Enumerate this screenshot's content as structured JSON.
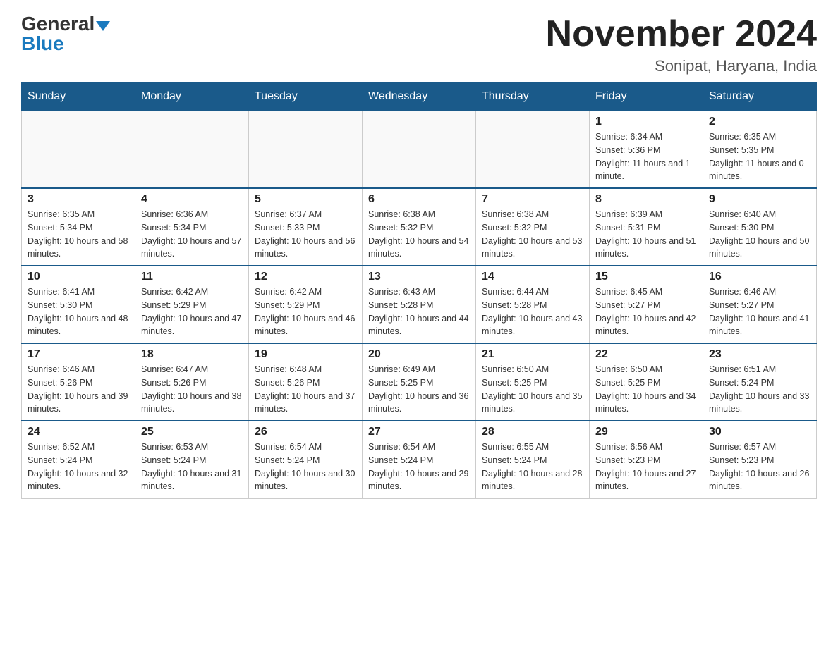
{
  "logo": {
    "general": "General",
    "blue": "Blue"
  },
  "title": "November 2024",
  "location": "Sonipat, Haryana, India",
  "days_of_week": [
    "Sunday",
    "Monday",
    "Tuesday",
    "Wednesday",
    "Thursday",
    "Friday",
    "Saturday"
  ],
  "weeks": [
    [
      {
        "day": "",
        "info": ""
      },
      {
        "day": "",
        "info": ""
      },
      {
        "day": "",
        "info": ""
      },
      {
        "day": "",
        "info": ""
      },
      {
        "day": "",
        "info": ""
      },
      {
        "day": "1",
        "info": "Sunrise: 6:34 AM\nSunset: 5:36 PM\nDaylight: 11 hours and 1 minute."
      },
      {
        "day": "2",
        "info": "Sunrise: 6:35 AM\nSunset: 5:35 PM\nDaylight: 11 hours and 0 minutes."
      }
    ],
    [
      {
        "day": "3",
        "info": "Sunrise: 6:35 AM\nSunset: 5:34 PM\nDaylight: 10 hours and 58 minutes."
      },
      {
        "day": "4",
        "info": "Sunrise: 6:36 AM\nSunset: 5:34 PM\nDaylight: 10 hours and 57 minutes."
      },
      {
        "day": "5",
        "info": "Sunrise: 6:37 AM\nSunset: 5:33 PM\nDaylight: 10 hours and 56 minutes."
      },
      {
        "day": "6",
        "info": "Sunrise: 6:38 AM\nSunset: 5:32 PM\nDaylight: 10 hours and 54 minutes."
      },
      {
        "day": "7",
        "info": "Sunrise: 6:38 AM\nSunset: 5:32 PM\nDaylight: 10 hours and 53 minutes."
      },
      {
        "day": "8",
        "info": "Sunrise: 6:39 AM\nSunset: 5:31 PM\nDaylight: 10 hours and 51 minutes."
      },
      {
        "day": "9",
        "info": "Sunrise: 6:40 AM\nSunset: 5:30 PM\nDaylight: 10 hours and 50 minutes."
      }
    ],
    [
      {
        "day": "10",
        "info": "Sunrise: 6:41 AM\nSunset: 5:30 PM\nDaylight: 10 hours and 48 minutes."
      },
      {
        "day": "11",
        "info": "Sunrise: 6:42 AM\nSunset: 5:29 PM\nDaylight: 10 hours and 47 minutes."
      },
      {
        "day": "12",
        "info": "Sunrise: 6:42 AM\nSunset: 5:29 PM\nDaylight: 10 hours and 46 minutes."
      },
      {
        "day": "13",
        "info": "Sunrise: 6:43 AM\nSunset: 5:28 PM\nDaylight: 10 hours and 44 minutes."
      },
      {
        "day": "14",
        "info": "Sunrise: 6:44 AM\nSunset: 5:28 PM\nDaylight: 10 hours and 43 minutes."
      },
      {
        "day": "15",
        "info": "Sunrise: 6:45 AM\nSunset: 5:27 PM\nDaylight: 10 hours and 42 minutes."
      },
      {
        "day": "16",
        "info": "Sunrise: 6:46 AM\nSunset: 5:27 PM\nDaylight: 10 hours and 41 minutes."
      }
    ],
    [
      {
        "day": "17",
        "info": "Sunrise: 6:46 AM\nSunset: 5:26 PM\nDaylight: 10 hours and 39 minutes."
      },
      {
        "day": "18",
        "info": "Sunrise: 6:47 AM\nSunset: 5:26 PM\nDaylight: 10 hours and 38 minutes."
      },
      {
        "day": "19",
        "info": "Sunrise: 6:48 AM\nSunset: 5:26 PM\nDaylight: 10 hours and 37 minutes."
      },
      {
        "day": "20",
        "info": "Sunrise: 6:49 AM\nSunset: 5:25 PM\nDaylight: 10 hours and 36 minutes."
      },
      {
        "day": "21",
        "info": "Sunrise: 6:50 AM\nSunset: 5:25 PM\nDaylight: 10 hours and 35 minutes."
      },
      {
        "day": "22",
        "info": "Sunrise: 6:50 AM\nSunset: 5:25 PM\nDaylight: 10 hours and 34 minutes."
      },
      {
        "day": "23",
        "info": "Sunrise: 6:51 AM\nSunset: 5:24 PM\nDaylight: 10 hours and 33 minutes."
      }
    ],
    [
      {
        "day": "24",
        "info": "Sunrise: 6:52 AM\nSunset: 5:24 PM\nDaylight: 10 hours and 32 minutes."
      },
      {
        "day": "25",
        "info": "Sunrise: 6:53 AM\nSunset: 5:24 PM\nDaylight: 10 hours and 31 minutes."
      },
      {
        "day": "26",
        "info": "Sunrise: 6:54 AM\nSunset: 5:24 PM\nDaylight: 10 hours and 30 minutes."
      },
      {
        "day": "27",
        "info": "Sunrise: 6:54 AM\nSunset: 5:24 PM\nDaylight: 10 hours and 29 minutes."
      },
      {
        "day": "28",
        "info": "Sunrise: 6:55 AM\nSunset: 5:24 PM\nDaylight: 10 hours and 28 minutes."
      },
      {
        "day": "29",
        "info": "Sunrise: 6:56 AM\nSunset: 5:23 PM\nDaylight: 10 hours and 27 minutes."
      },
      {
        "day": "30",
        "info": "Sunrise: 6:57 AM\nSunset: 5:23 PM\nDaylight: 10 hours and 26 minutes."
      }
    ]
  ]
}
